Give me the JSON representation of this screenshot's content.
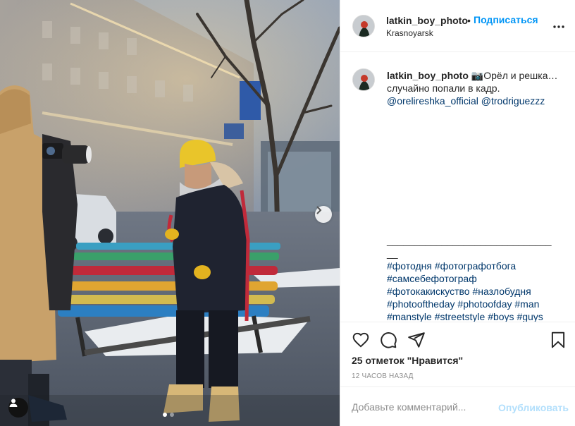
{
  "post": {
    "username": "latkin_boy_photo",
    "separator": "•",
    "follow_label": "Подписаться",
    "location": "Krasnoyarsk",
    "more_icon": "more-horizontal-icon"
  },
  "caption": {
    "username": "latkin_boy_photo",
    "emoji": "📷",
    "line1": "Орёл и решка…",
    "line2": "случайно попали в кадр.",
    "mention1": "@orelireshka_official",
    "mention2": "@trodriguezzz",
    "divider": "________________________________",
    "hashtags": [
      "#фотодня",
      "#фотографотбога",
      "#самсебефотограф",
      "#фотокакискуство",
      "#назлобудня",
      "#photooftheday",
      "#photoofday",
      "#man",
      "#manstyle",
      "#streetstyle",
      "#boys",
      "#guys"
    ]
  },
  "actions": {
    "like_icon": "heart-icon",
    "comment_icon": "comment-icon",
    "share_icon": "share-icon",
    "save_icon": "bookmark-icon",
    "likes_text": "25 отметок \"Нравится\"",
    "time_text": "12 ЧАСОВ НАЗАД"
  },
  "comment": {
    "placeholder": "Добавьте комментарий...",
    "publish_label": "Опубликовать"
  },
  "carousel": {
    "total_slides": 2,
    "active_slide": 1,
    "next_icon": "chevron-right-icon",
    "tag_icon": "user-tag-icon"
  },
  "colors": {
    "accent": "#0095f6",
    "link": "#00376b",
    "muted": "#8e8e8e",
    "publish_disabled": "#b2dffc"
  }
}
